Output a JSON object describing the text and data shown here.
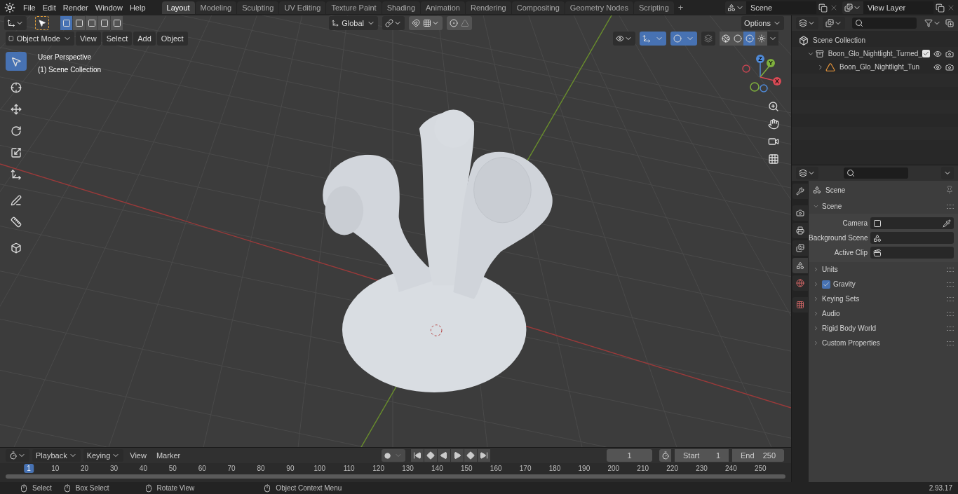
{
  "topbar": {
    "menus": [
      "File",
      "Edit",
      "Render",
      "Window",
      "Help"
    ],
    "workspaces": [
      {
        "label": "Layout",
        "selected": true
      },
      {
        "label": "Modeling",
        "selected": false
      },
      {
        "label": "Sculpting",
        "selected": false
      },
      {
        "label": "UV Editing",
        "selected": false
      },
      {
        "label": "Texture Paint",
        "selected": false
      },
      {
        "label": "Shading",
        "selected": false
      },
      {
        "label": "Animation",
        "selected": false
      },
      {
        "label": "Rendering",
        "selected": false
      },
      {
        "label": "Compositing",
        "selected": false
      },
      {
        "label": "Geometry Nodes",
        "selected": false
      },
      {
        "label": "Scripting",
        "selected": false
      }
    ],
    "add_tab": "+",
    "scene": "Scene",
    "view_layer": "View Layer"
  },
  "viewport": {
    "select_modes": [
      {
        "selected": true
      },
      {
        "selected": false
      },
      {
        "selected": false
      },
      {
        "selected": false
      },
      {
        "selected": false
      }
    ],
    "orientation": "Global",
    "options": "Options",
    "mode": "Object Mode",
    "menus": [
      "View",
      "Select",
      "Add",
      "Object"
    ],
    "shading": [
      {
        "kind": "wireframe",
        "selected": false
      },
      {
        "kind": "solid",
        "selected": false
      },
      {
        "kind": "material",
        "selected": true
      },
      {
        "kind": "rendered",
        "selected": false
      }
    ],
    "overlay_text": [
      "User Perspective",
      "(1) Scene Collection"
    ],
    "tools": [
      {
        "kind": "select",
        "selected": true
      },
      {
        "kind": "cursor",
        "selected": false
      },
      {
        "kind": "move",
        "selected": false
      },
      {
        "kind": "rotate",
        "selected": false
      },
      {
        "kind": "scale",
        "selected": false
      },
      {
        "kind": "transform",
        "selected": false
      },
      {
        "kind": "annotate",
        "selected": false
      },
      {
        "kind": "measure",
        "selected": false
      },
      {
        "kind": "add-cube",
        "selected": false
      }
    ],
    "gizmo_axes": [
      "Z",
      "Y",
      "X"
    ]
  },
  "outliner": {
    "items": [
      {
        "label": "Scene Collection",
        "kind": "scene",
        "children": [
          {
            "label": "Boon_Glo_Nightlight_Turned_",
            "kind": "collection",
            "expanded": true,
            "checked": true,
            "children": [
              {
                "label": "Boon_Glo_Nightlight_Tun",
                "kind": "object",
                "expanded": false
              }
            ]
          }
        ]
      }
    ]
  },
  "properties": {
    "tabs": [
      {
        "kind": "tool",
        "selected": false
      },
      {
        "kind": "render",
        "selected": false
      },
      {
        "kind": "output",
        "selected": false
      },
      {
        "kind": "view_layer",
        "selected": false
      },
      {
        "kind": "scene",
        "selected": true
      },
      {
        "kind": "world",
        "selected": false
      },
      {
        "kind": "texture",
        "selected": false
      }
    ],
    "context": "Scene",
    "panels": [
      {
        "label": "Scene",
        "expanded": true,
        "fields": [
          {
            "label": "Camera",
            "kind": "camera"
          },
          {
            "label": "Background Scene",
            "kind": "scene"
          },
          {
            "label": "Active Clip",
            "kind": "clip"
          }
        ]
      },
      {
        "label": "Units",
        "expanded": false
      },
      {
        "label": "Gravity",
        "expanded": false,
        "checked": true
      },
      {
        "label": "Keying Sets",
        "expanded": false
      },
      {
        "label": "Audio",
        "expanded": false
      },
      {
        "label": "Rigid Body World",
        "expanded": false
      },
      {
        "label": "Custom Properties",
        "expanded": false
      }
    ]
  },
  "timeline": {
    "menus": [
      "Playback",
      "Keying",
      "View",
      "Marker"
    ],
    "current_frame": "1",
    "start_label": "Start",
    "start": "1",
    "end_label": "End",
    "end": "250",
    "ruler": [
      {
        "label": "1",
        "selected": true
      },
      {
        "label": "10",
        "selected": false
      },
      {
        "label": "20",
        "selected": false
      },
      {
        "label": "30",
        "selected": false
      },
      {
        "label": "40",
        "selected": false
      },
      {
        "label": "50",
        "selected": false
      },
      {
        "label": "60",
        "selected": false
      },
      {
        "label": "70",
        "selected": false
      },
      {
        "label": "80",
        "selected": false
      },
      {
        "label": "90",
        "selected": false
      },
      {
        "label": "100",
        "selected": false
      },
      {
        "label": "110",
        "selected": false
      },
      {
        "label": "120",
        "selected": false
      },
      {
        "label": "130",
        "selected": false
      },
      {
        "label": "140",
        "selected": false
      },
      {
        "label": "150",
        "selected": false
      },
      {
        "label": "160",
        "selected": false
      },
      {
        "label": "170",
        "selected": false
      },
      {
        "label": "180",
        "selected": false
      },
      {
        "label": "190",
        "selected": false
      },
      {
        "label": "200",
        "selected": false
      },
      {
        "label": "210",
        "selected": false
      },
      {
        "label": "220",
        "selected": false
      },
      {
        "label": "230",
        "selected": false
      },
      {
        "label": "240",
        "selected": false
      },
      {
        "label": "250",
        "selected": false
      }
    ]
  },
  "status_bar": {
    "hints": [
      "Select",
      "Box Select",
      "Rotate View",
      "Object Context Menu"
    ],
    "version": "2.93.17"
  }
}
